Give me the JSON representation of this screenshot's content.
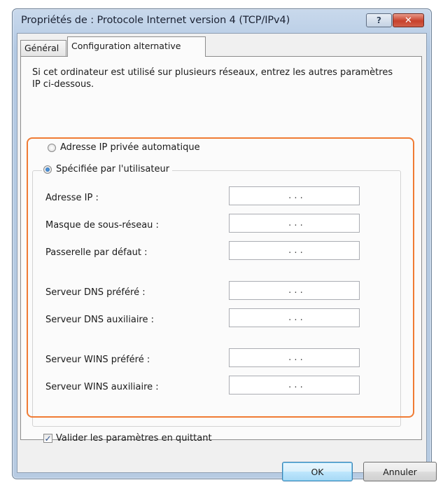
{
  "window": {
    "title": "Propriétés de : Protocole Internet version 4 (TCP/IPv4)",
    "help_glyph": "?",
    "close_glyph": "✕"
  },
  "tabs": [
    {
      "label": "Général"
    },
    {
      "label": "Configuration alternative"
    }
  ],
  "description": "Si cet ordinateur est utilisé sur plusieurs réseaux, entrez les autres paramètres IP ci-dessous.",
  "options": {
    "auto": {
      "label": "Adresse IP privée automatique",
      "checked": false
    },
    "user": {
      "label": "Spécifiée par l'utilisateur",
      "checked": true
    }
  },
  "fields": [
    {
      "label": "Adresse IP :",
      "value": ". . ."
    },
    {
      "label": "Masque de sous-réseau :",
      "value": ". . ."
    },
    {
      "label": "Passerelle par défaut :",
      "value": ". . ."
    },
    {
      "label": "Serveur DNS préféré :",
      "value": ". . ."
    },
    {
      "label": "Serveur DNS auxiliaire :",
      "value": ". . ."
    },
    {
      "label": "Serveur WINS préféré :",
      "value": ". . ."
    },
    {
      "label": "Serveur WINS auxiliaire :",
      "value": ". . ."
    }
  ],
  "validate": {
    "label": "Valider les paramètres en quittant",
    "checked": true,
    "glyph": "✓"
  },
  "buttons": {
    "ok": "OK",
    "cancel": "Annuler"
  },
  "colors": {
    "highlight": "#f07b34",
    "title_bar": "#b9cce4"
  }
}
